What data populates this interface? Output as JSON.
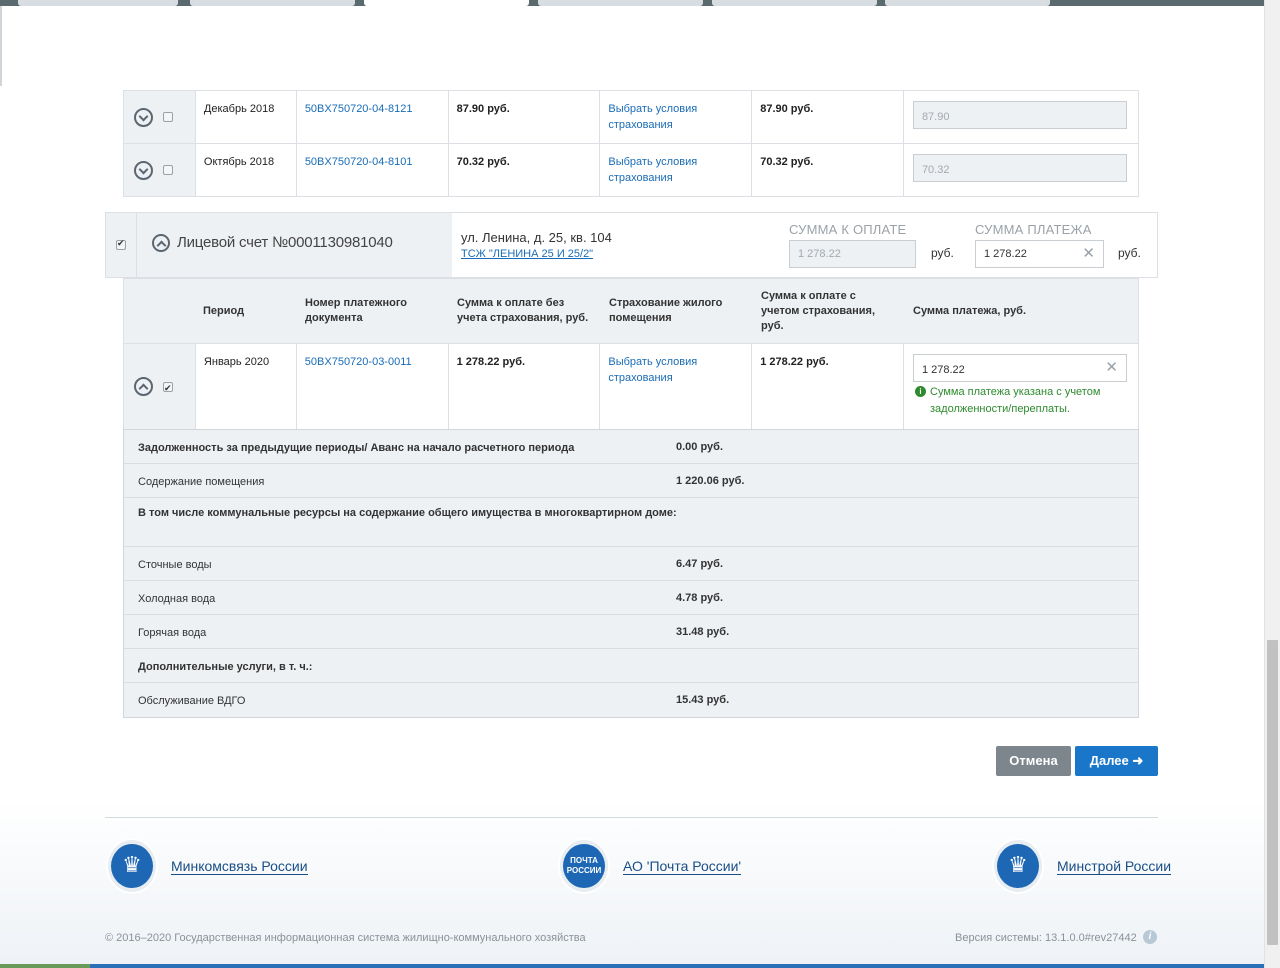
{
  "prev_rows": [
    {
      "period": "Декабрь 2018",
      "doc": "50BX750720-04-8121",
      "sum": "87.90 руб.",
      "insurance": "Выбрать условия страхования",
      "sum_ins": "87.90 руб.",
      "pay": "87.90"
    },
    {
      "period": "Октябрь 2018",
      "doc": "50BX750720-04-8101",
      "sum": "70.32 руб.",
      "insurance": "Выбрать условия страхования",
      "sum_ins": "70.32 руб.",
      "pay": "70.32"
    }
  ],
  "account": {
    "title": "Лицевой счет №0001130981040",
    "address": "ул. Ленина, д. 25, кв. 104",
    "org": "ТСЖ \"ЛЕНИНА 25 И 25/2\"",
    "sum_label": "СУММА К ОПЛАТЕ",
    "sum_value": "1 278.22",
    "pay_label": "СУММА ПЛАТЕЖА",
    "pay_value": "1 278.22",
    "currency": "руб."
  },
  "headers": {
    "period": "Период",
    "doc": "Номер платежного документа",
    "sum": "Сумма к оплате без учета страхования, руб.",
    "insurance": "Страхование жилого помещения",
    "sum_ins": "Сумма к оплате с учетом страхования, руб.",
    "pay": "Сумма платежа, руб."
  },
  "current_row": {
    "period": "Январь 2020",
    "doc": "50BX750720-03-0011",
    "sum": "1 278.22 руб.",
    "insurance": "Выбрать условия страхования",
    "sum_ins": "1 278.22 руб.",
    "pay": "1 278.22",
    "hint": "Сумма платежа указана с учетом задолженности/переплаты."
  },
  "details": [
    {
      "label": "Задолженность за предыдущие периоды/ Аванс на начало расчетного периода",
      "value": "0.00 руб.",
      "bold": true
    },
    {
      "label": "Содержание помещения",
      "value": "1 220.06 руб.",
      "bold": false
    },
    {
      "label": "В том числе коммунальные ресурсы на содержание общего имущества в многоквартирном доме:",
      "value": "",
      "bold": true
    },
    {
      "label": "Сточные воды",
      "value": "6.47 руб.",
      "bold": false
    },
    {
      "label": "Холодная вода",
      "value": "4.78 руб.",
      "bold": false
    },
    {
      "label": "Горячая вода",
      "value": "31.48 руб.",
      "bold": false
    },
    {
      "label": "Дополнительные услуги, в т. ч.:",
      "value": "",
      "bold": true
    },
    {
      "label": "Обслуживание ВДГО",
      "value": "15.43 руб.",
      "bold": false
    }
  ],
  "buttons": {
    "cancel": "Отмена",
    "next": "Далее"
  },
  "footer": {
    "link1": "Минкомсвязь России",
    "link2": "АО 'Почта России'",
    "link3": "Минстрой России",
    "post_logo": "ПОЧТА РОССИИ",
    "copyright": "© 2016–2020 Государственная информационная система жилищно-коммунального хозяйства",
    "version": "Версия системы: 13.1.0.0#rev27442"
  }
}
